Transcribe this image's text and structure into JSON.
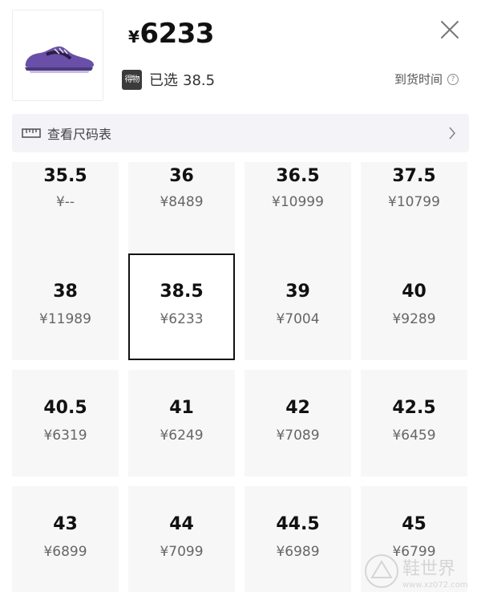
{
  "header": {
    "currency": "¥",
    "price": "6233",
    "badge_text": "得物",
    "selected_label": "已选",
    "selected_size": "38.5",
    "arrival_label": "到货时间",
    "close_icon": "close-icon",
    "help_icon": "question-circle-icon"
  },
  "size_chart": {
    "label": "查看尺码表",
    "icon": "ruler-icon",
    "chevron": "chevron-right-icon"
  },
  "sizes": [
    {
      "size": "35.5",
      "price": "¥--"
    },
    {
      "size": "36",
      "price": "¥8489"
    },
    {
      "size": "36.5",
      "price": "¥10999"
    },
    {
      "size": "37.5",
      "price": "¥10799"
    },
    {
      "size": "38",
      "price": "¥11989"
    },
    {
      "size": "38.5",
      "price": "¥6233",
      "selected": true
    },
    {
      "size": "39",
      "price": "¥7004"
    },
    {
      "size": "40",
      "price": "¥9289"
    },
    {
      "size": "40.5",
      "price": "¥6319"
    },
    {
      "size": "41",
      "price": "¥6249"
    },
    {
      "size": "42",
      "price": "¥7089"
    },
    {
      "size": "42.5",
      "price": "¥6459"
    },
    {
      "size": "43",
      "price": "¥6899"
    },
    {
      "size": "44",
      "price": "¥7099"
    },
    {
      "size": "44.5",
      "price": "¥6989"
    },
    {
      "size": "45",
      "price": "¥6799"
    }
  ],
  "watermark": {
    "text": "鞋世界",
    "subtext": "www.xz072.com"
  },
  "colors": {
    "accent": "#111111",
    "cell_bg": "#f7f7f7",
    "bar_bg": "#f4f4f8",
    "shoe": "#6a4fa8"
  }
}
